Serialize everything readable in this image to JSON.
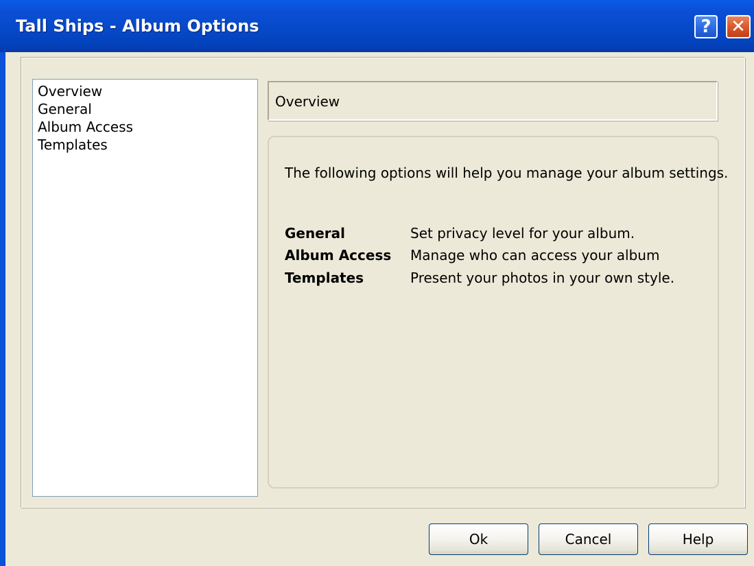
{
  "window": {
    "title": "Tall Ships - Album Options",
    "help_glyph": "?",
    "close_glyph": "✕"
  },
  "sidebar": {
    "items": [
      {
        "label": "Overview"
      },
      {
        "label": "General"
      },
      {
        "label": "Album Access"
      },
      {
        "label": "Templates"
      }
    ]
  },
  "main": {
    "header": "Overview",
    "intro": "The following options will help you manage your album settings.",
    "options": [
      {
        "name": "General",
        "description": "Set privacy level for your album."
      },
      {
        "name": "Album Access",
        "description": "Manage who can access your album"
      },
      {
        "name": "Templates",
        "description": "Present your photos in your own style."
      }
    ]
  },
  "buttons": {
    "ok": "Ok",
    "cancel": "Cancel",
    "help": "Help"
  },
  "colors": {
    "titlebar": "#0b4fd6",
    "dialog_bg": "#ece9d8",
    "close_button": "#d85a2e",
    "help_button": "#2e6de4"
  },
  "icons": {
    "help": "question-mark-icon",
    "close": "close-icon"
  }
}
